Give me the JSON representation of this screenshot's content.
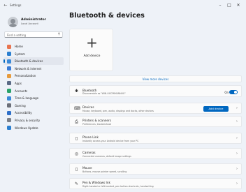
{
  "window": {
    "title": "Settings",
    "back_glyph": "←",
    "minimize_glyph": "–",
    "maximize_glyph": "□",
    "close_glyph": "✕"
  },
  "profile": {
    "name": "Administrator",
    "account_type": "Local Account"
  },
  "search": {
    "placeholder": "Find a setting",
    "icon": "search-icon"
  },
  "sidebar": {
    "items": [
      {
        "label": "Home",
        "icon": "home-icon",
        "color": "#e8744f"
      },
      {
        "label": "System",
        "icon": "monitor-icon",
        "color": "#2b7fd0"
      },
      {
        "label": "Bluetooth & devices",
        "icon": "bluetooth-devices-icon",
        "color": "#3b8ad8",
        "selected": true
      },
      {
        "label": "Network & internet",
        "icon": "wifi-icon",
        "color": "#3a7bd5"
      },
      {
        "label": "Personalization",
        "icon": "brush-icon",
        "color": "#e79b3c"
      },
      {
        "label": "Apps",
        "icon": "apps-icon",
        "color": "#5a6a85"
      },
      {
        "label": "Accounts",
        "icon": "person-icon",
        "color": "#2aa36b"
      },
      {
        "label": "Time & language",
        "icon": "clock-globe-icon",
        "color": "#3b8ad8"
      },
      {
        "label": "Gaming",
        "icon": "gamepad-icon",
        "color": "#6b6f78"
      },
      {
        "label": "Accessibility",
        "icon": "accessibility-icon",
        "color": "#2d6fc9"
      },
      {
        "label": "Privacy & security",
        "icon": "shield-icon",
        "color": "#7a7f88"
      },
      {
        "label": "Windows Update",
        "icon": "update-icon",
        "color": "#2b7fd0"
      }
    ]
  },
  "page": {
    "title": "Bluetooth & devices",
    "add_device_tile": {
      "label": "Add device",
      "glyph": "+"
    },
    "view_more": "View more devices"
  },
  "cards": {
    "bluetooth": {
      "title": "Bluetooth",
      "desc": "Discoverable as \"WIN-UXI7WM4NNUX\"",
      "state": "On",
      "on": true,
      "glyph": "✱"
    },
    "devices": {
      "title": "Devices",
      "desc": "Mouse, keyboard, pen, audio, displays and docks, other devices",
      "button": "Add device",
      "glyph": "⌨"
    },
    "printers": {
      "title": "Printers & scanners",
      "desc": "Preferences, troubleshoot",
      "glyph": "⎙"
    },
    "phone_link": {
      "title": "Phone Link",
      "desc": "Instantly access your Android device from your PC",
      "glyph": "▯"
    },
    "cameras": {
      "title": "Cameras",
      "desc": "Connected cameras, default image settings",
      "glyph": "◎"
    },
    "mouse": {
      "title": "Mouse",
      "desc": "Buttons, mouse pointer speed, scrolling",
      "glyph": "▯"
    },
    "pen": {
      "title": "Pen & Windows Ink",
      "desc": "Right-handed or left-handed, pen button shortcuts, handwriting",
      "glyph": "✎"
    }
  },
  "chevron": "›"
}
